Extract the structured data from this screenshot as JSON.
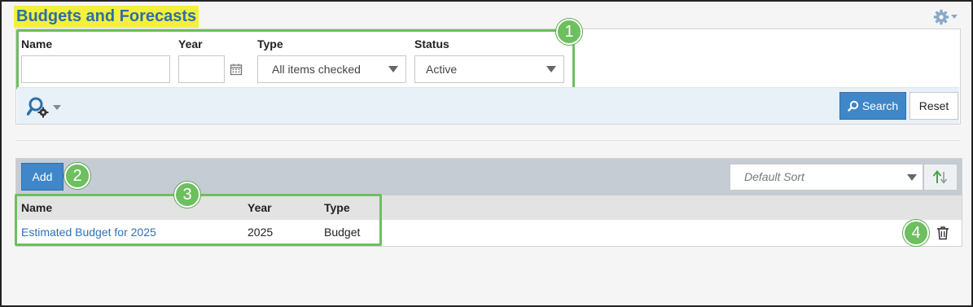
{
  "page": {
    "title": "Budgets and Forecasts"
  },
  "filters": {
    "name_label": "Name",
    "name_value": "",
    "year_label": "Year",
    "year_value": "",
    "type_label": "Type",
    "type_value": "All items checked",
    "status_label": "Status",
    "status_value": "Active"
  },
  "toolbar": {
    "search_label": "Search",
    "reset_label": "Reset"
  },
  "results": {
    "add_label": "Add",
    "sort_placeholder": "Default Sort",
    "columns": [
      "Name",
      "Year",
      "Type"
    ],
    "rows": [
      {
        "name": "Estimated Budget for 2025",
        "year": "2025",
        "type": "Budget"
      }
    ]
  },
  "callouts": [
    "1",
    "2",
    "3",
    "4"
  ],
  "colors": {
    "accent_blue": "#3f87c9",
    "title_blue": "#2d6fa6",
    "highlight_yellow": "#f4f03c",
    "callout_green": "#6dbf5f",
    "link_blue": "#2d72b8"
  },
  "icons": [
    "gear-icon",
    "calendar-icon",
    "advanced-search-icon",
    "search-icon",
    "sort-direction-icon",
    "trash-icon",
    "caret-down-icon"
  ]
}
